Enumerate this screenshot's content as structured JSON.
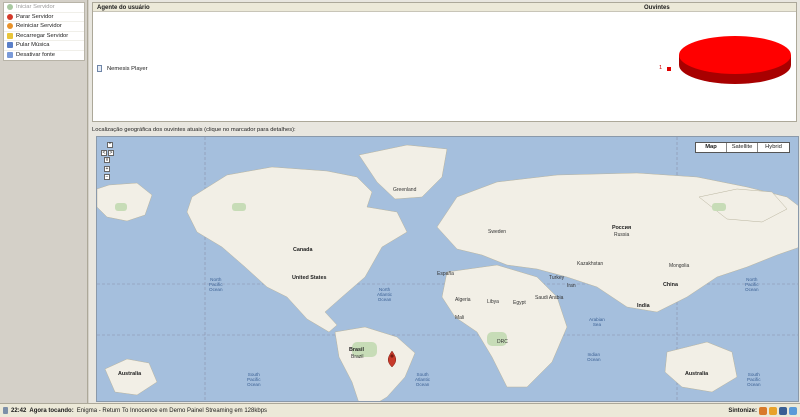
{
  "sidebar": {
    "items": [
      {
        "label": "Iniciar Servidor",
        "icon": "play-icon",
        "color": "#a8c8a0",
        "disabled": true
      },
      {
        "label": "Parar Servidor",
        "icon": "stop-icon",
        "color": "#d43a2a",
        "disabled": false
      },
      {
        "label": "Reiniciar Servidor",
        "icon": "restart-icon",
        "color": "#e8922a",
        "disabled": false
      },
      {
        "label": "Recarregar Servidor",
        "icon": "reload-icon",
        "color": "#e8c43a",
        "disabled": false
      },
      {
        "label": "Pular Música",
        "icon": "skip-icon",
        "color": "#5a7fc8",
        "disabled": false
      },
      {
        "label": "Desativar fonte",
        "icon": "disable-source-icon",
        "color": "#7a9ad8",
        "disabled": false
      }
    ]
  },
  "listeners": {
    "header_agent": "Agente do usuário",
    "header_count": "Ouvintes",
    "rows": [
      {
        "agent": "Nemesis Player",
        "count": "1",
        "color": "#e00000"
      }
    ]
  },
  "geo_label": "Localização geográfica dos ouvintes atuais (clique no marcador para detalhes):",
  "map": {
    "types": [
      "Map",
      "Satellite",
      "Hybrid"
    ],
    "active_type": "Map",
    "nav": {
      "up": "^",
      "left": "<",
      "right": ">",
      "down": "v",
      "zoom_in": "+",
      "zoom_out": "−"
    },
    "labels": {
      "greenland": "Greenland",
      "canada": "Canada",
      "united_states": "United States",
      "brasil": "Brasil",
      "brazil": "Brazil",
      "australia_1": "Australia",
      "australia_2": "Australia",
      "india": "India",
      "russia": "Россия",
      "russia_en": "Russia",
      "kazakhstan": "Kazakhstan",
      "mongolia": "Mongolia",
      "china": "China",
      "saudi_arabia": "Saudi Arabia",
      "turkey": "Turkey",
      "sweden": "Sweden",
      "espana": "España",
      "algeria": "Algeria",
      "libya": "Libya",
      "egypt": "Egypt",
      "iran": "Iran",
      "mali": "Mali",
      "drc": "DRC",
      "north_atlantic": "North\nAtlantic\nOcean",
      "south_atlantic": "South\nAtlantic\nOcean",
      "north_pacific_1": "North\nPacific\nOcean",
      "north_pacific_2": "North\nPacific\nOcean",
      "south_pacific_1": "South\nPacific\nOcean",
      "south_pacific_2": "South\nPacific\nOcean",
      "indian_ocean": "Indian\nOcean",
      "arabian_sea": "Arabian\nSea"
    }
  },
  "status": {
    "time": "22:42",
    "now_playing_label": "Agora tocando:",
    "now_playing": "Enigma - Return To Innocence em Demo Painel Streaming em 128kbps",
    "tune_label": "Sintonize:",
    "tray_icons": [
      {
        "name": "winamp-icon",
        "color": "#d87a2a"
      },
      {
        "name": "media-player-icon",
        "color": "#e8a22a"
      },
      {
        "name": "realplayer-icon",
        "color": "#3a5f93"
      },
      {
        "name": "quicktime-icon",
        "color": "#5a9ad8"
      }
    ]
  }
}
